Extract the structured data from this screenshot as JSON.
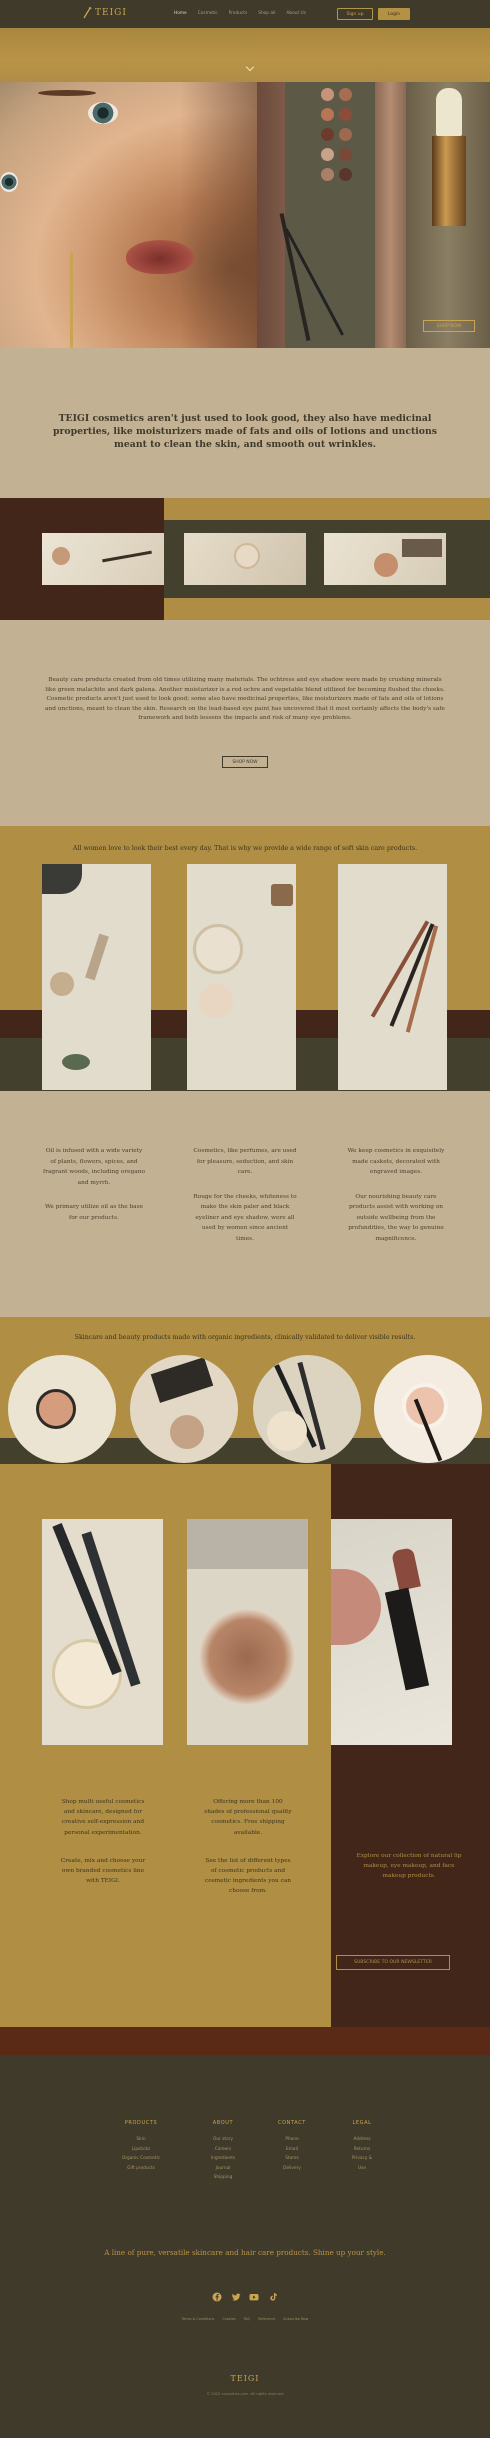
{
  "header": {
    "logo_text": "TEIGI",
    "nav": [
      "Home",
      "Cosmetic",
      "Products",
      "Shop all",
      "About Us"
    ],
    "signup_label": "Sign up",
    "login_label": "Login"
  },
  "hero": {
    "shop_now_label": "SHOP NOW"
  },
  "intro": {
    "text": "TEIGI cosmetics aren't just used to look good, they also have medicinal properties, like moisturizers made of fats and oils of lotions and unctions meant to clean the skin, and smooth out wrinkles."
  },
  "about": {
    "text": "Beauty care products created from old times utilizing many materials. The ochtress and eye shadow were made by crushing minerals like green malachite and dark galena. Another moisturizer is a red ochre and vegetable blend utilized for becoming flushed the cheeks. Cosmetic products aren't just used to look good; some also have medicinal properties, like moisturizers made of fats and oils of lotions and unctions, meant to clean the skin. Research on the lead-based eye paint has uncovered that it most certainly affects the body's safe framework and both lessens the impacts and risk of many eye problems.",
    "button_label": "SHOP NOW"
  },
  "gallery": {
    "caption": "All women love to look their best every day. That is why we provide a wide range of soft skin care products."
  },
  "columns": [
    {
      "p1": "Oil is infused with a wide variety of plants, flowers, spices, and fragrant woods, including oregano and myrrh.",
      "p2": "We primary utilize oil as the base for our products."
    },
    {
      "p1": "Cosmetics, like perfumes, are used for pleasure, seduction, and skin care.",
      "p2": "Rouge for the cheeks, whiteness to make the skin paler and black eyeliner and eye shadow, were all used by women since ancient times."
    },
    {
      "p1": "We keep cosmetics in exquisitely made caskets, decorated with engraved images.",
      "p2": "Our nourishing beauty care products assist with working on outside wellbeing from the profundities, the way to genuine magnificence."
    }
  ],
  "circles_caption": "Skincare and beauty products made with organic ingredients, clinically validated to deliver visible results.",
  "lower": {
    "col1": {
      "p1": "Shop multi useful cosmetics and skincare, designed for creative self-expression and personal experimentation.",
      "p2": "Create, mix and choose your own branded cosmetics line with TEIGI."
    },
    "col2": {
      "p1": "Offering more than 100 shades of professional quality cosmetics. Free shipping available.",
      "p2": "See the list of different types of cosmetic products and cosmetic ingredients you can choose from."
    },
    "dark_text": "Explore our collection of natural lip makeup, eye makeup, and face makeup products.",
    "newsletter_label": "SUBSCRIBE TO OUR NEWSLETTER"
  },
  "footer": {
    "columns": [
      {
        "title": "PRODUCTS",
        "items": [
          "Skin",
          "Lipsticks",
          "Organic Cosmetic",
          "Gift products"
        ]
      },
      {
        "title": "ABOUT",
        "items": [
          "Our story",
          "Careers",
          "Ingredients",
          "Journal",
          "Shipping"
        ]
      },
      {
        "title": "CONTACT",
        "items": [
          "Phone",
          "Email",
          "Stores",
          "Delivery"
        ]
      },
      {
        "title": "LEGAL",
        "items": [
          "Address",
          "Returns",
          "Privacy & ",
          "Use"
        ]
      }
    ],
    "tagline": "A line of pure, versatile skincare and hair care products. Shine up your style.",
    "social_icons": [
      "facebook-icon",
      "twitter-icon",
      "youtube-icon",
      "tiktok-icon"
    ],
    "links": [
      "Terms & Conditions",
      "Cookies",
      "FAQ",
      "Reference",
      "Subscribe Now"
    ],
    "logo_text": "TEIGI",
    "copyright": "© 2022 cosmetics.com. All rights reserved"
  }
}
